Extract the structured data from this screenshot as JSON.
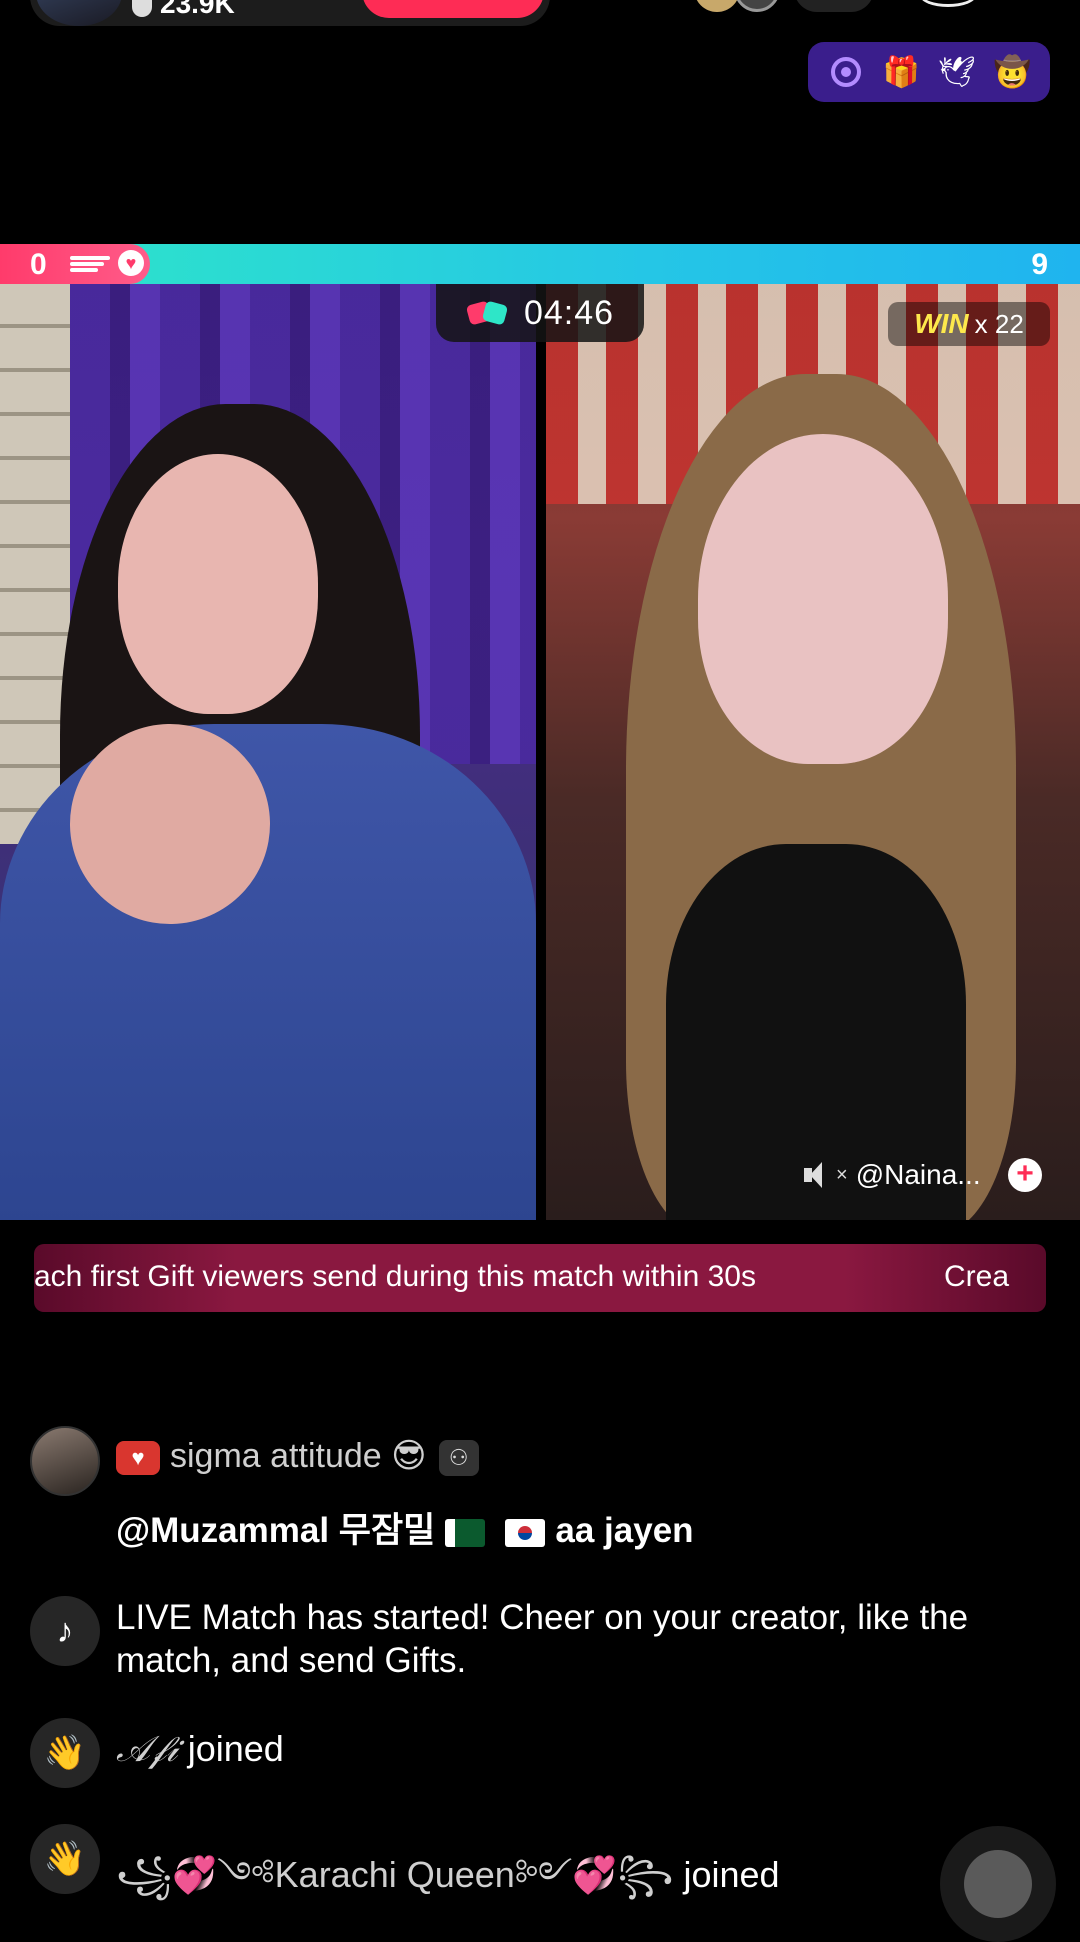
{
  "header": {
    "likes": "23.9K"
  },
  "boosters": {
    "items": [
      "target",
      "gift-box",
      "bird",
      "cowboy-hat"
    ],
    "glyphs": [
      "",
      "🎁",
      "🕊",
      "🤠"
    ]
  },
  "match": {
    "left_score": "0",
    "right_score": "9",
    "timer": "04:46",
    "win_label": "WIN",
    "win_count": "x 22",
    "guest_name": "@Naina...",
    "banner_text": "ach first Gift viewers send during this match within 30s",
    "banner_text_next": "Crea"
  },
  "colors": {
    "accent": "#fe2c55",
    "score_left": "#ff3b6b",
    "score_right": "#25c6e6",
    "win": "#fde84c",
    "booster_bg": "#3a1e8c"
  },
  "chat": {
    "comment": {
      "username": "sigma attitude 😎",
      "message": "@Muzammal 무잠밀",
      "message_tail": "aa jayen"
    },
    "system": {
      "text": "LIVE Match has started! Cheer on your creator, like the match, and send Gifts."
    },
    "joins": [
      {
        "name": "𝒜𝒻𝒾",
        "action": "joined"
      },
      {
        "name": "꧁💞༺Karachi Queen༻💞꧂",
        "action": "joined"
      }
    ]
  }
}
